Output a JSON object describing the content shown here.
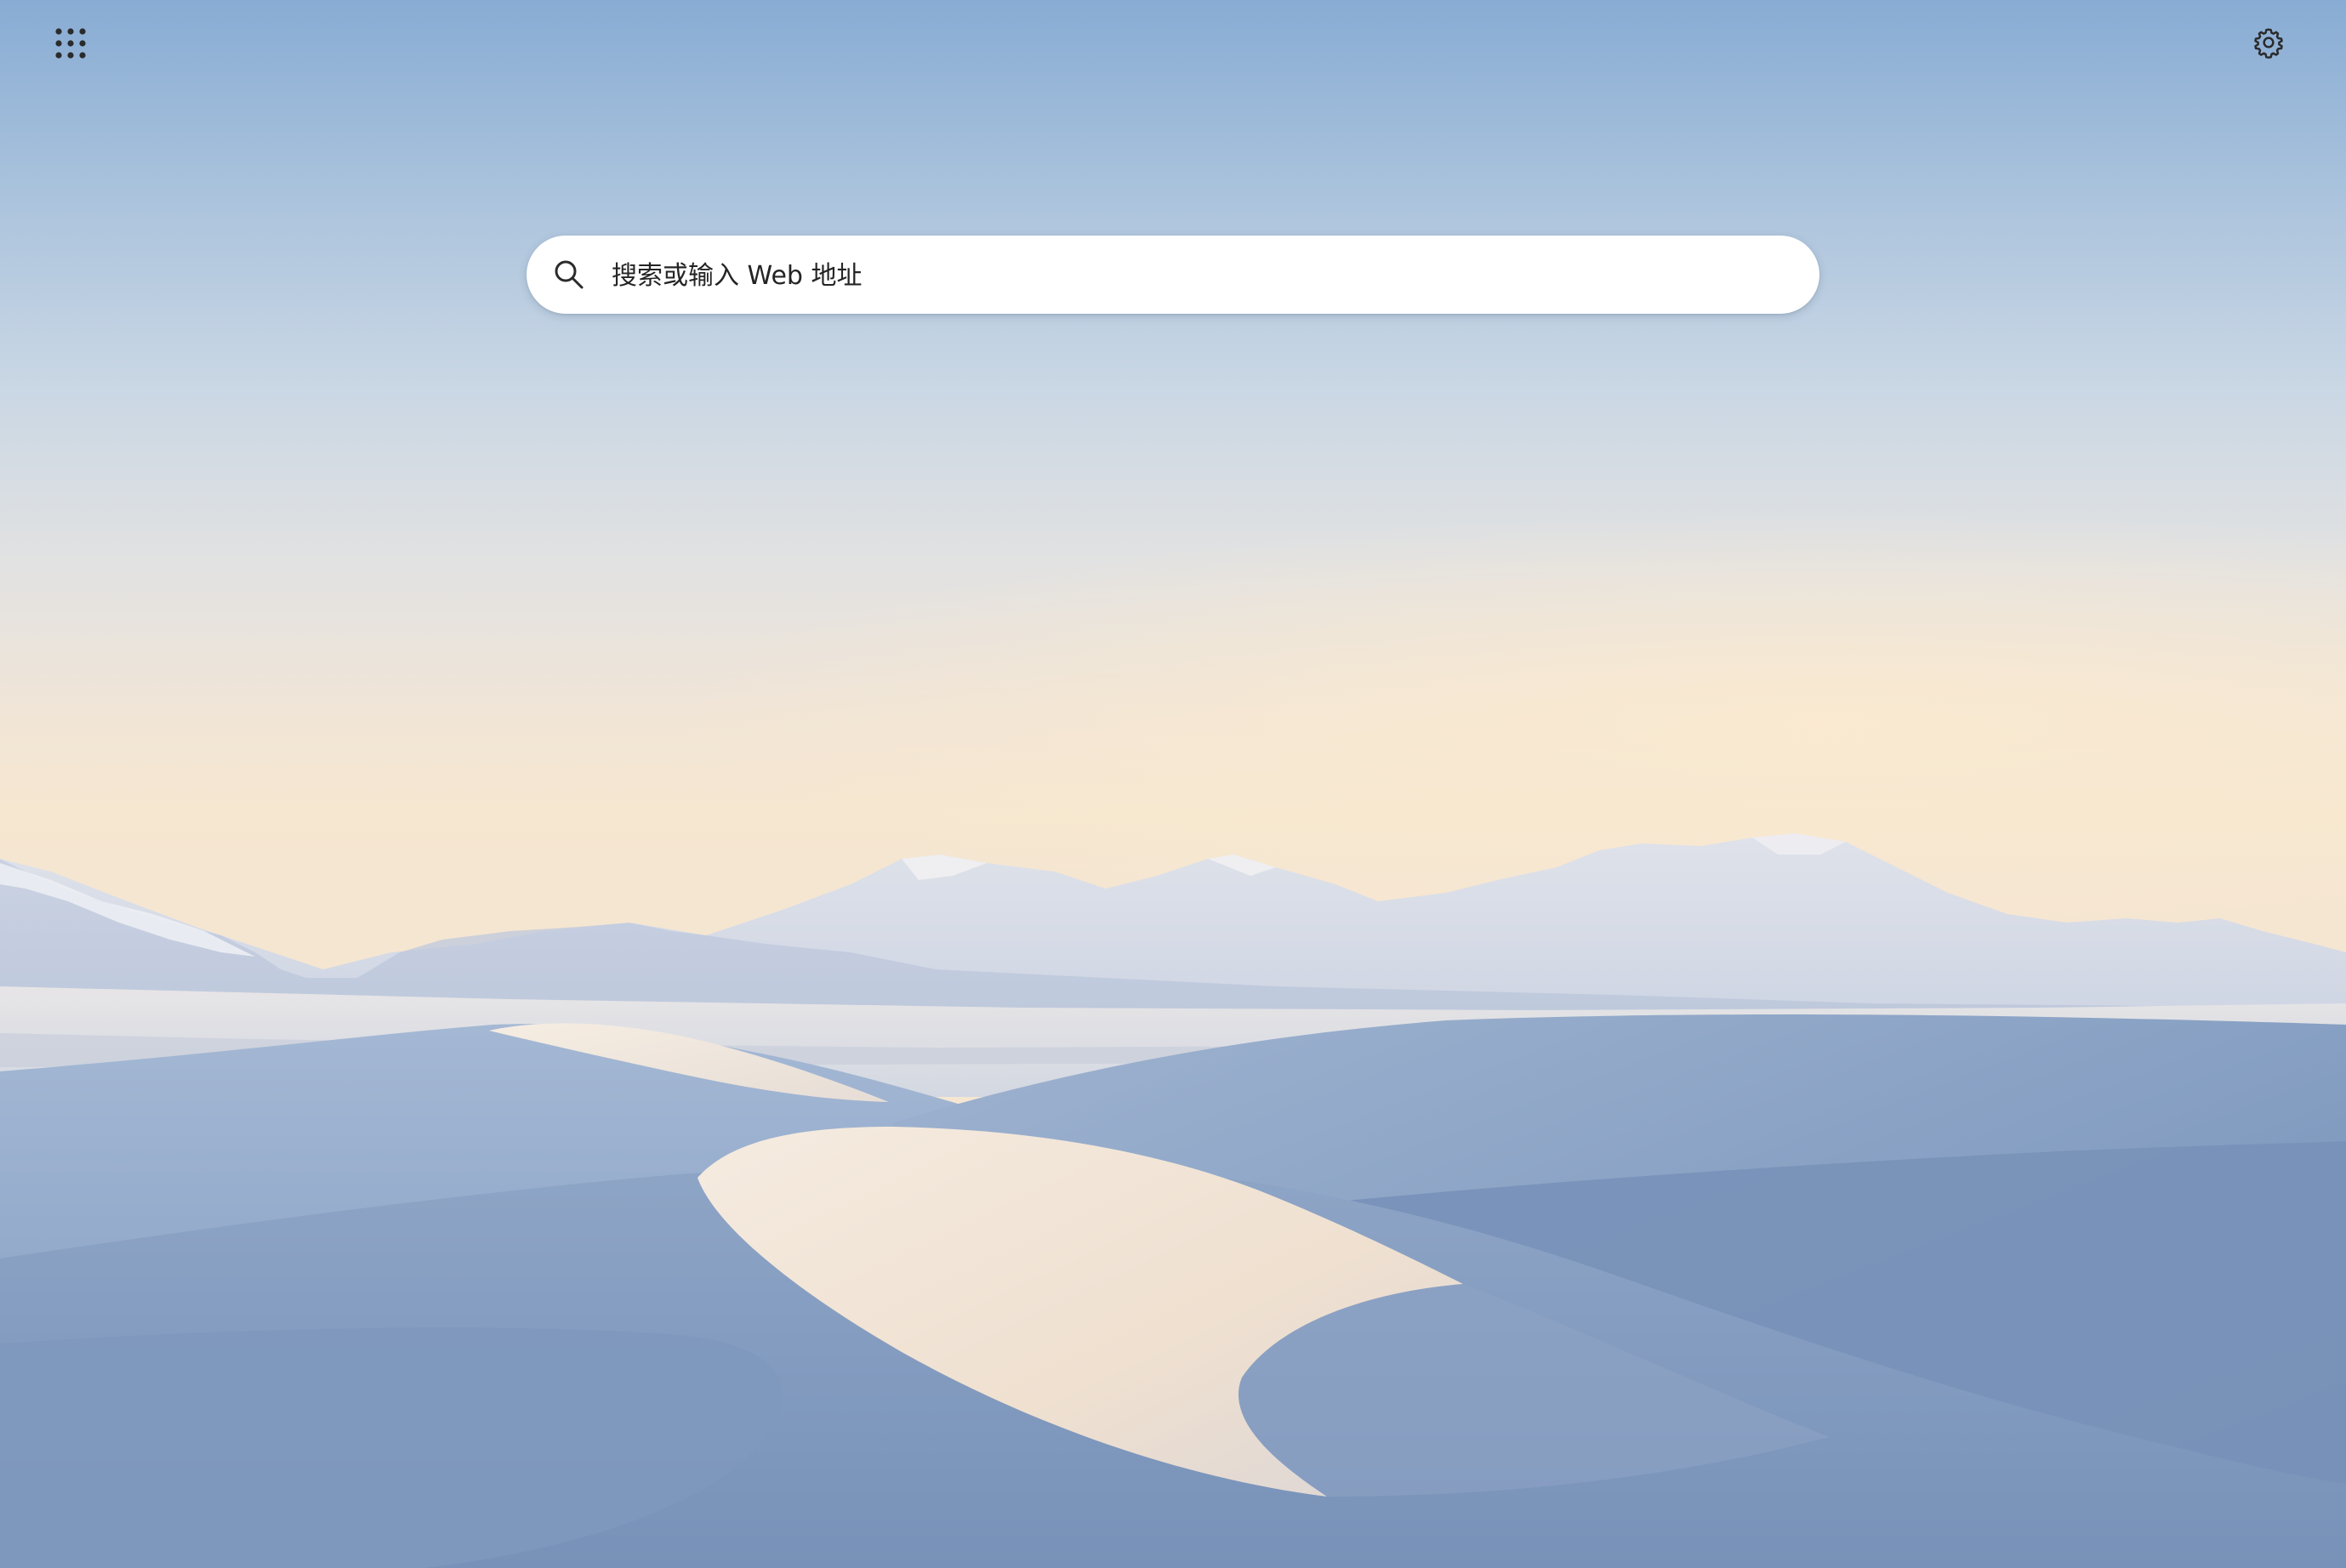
{
  "toolbar": {
    "apps_icon": "apps-grid-icon",
    "settings_icon": "gear-icon"
  },
  "search": {
    "placeholder": "搜索或输入 Web 地址",
    "value": "",
    "icon": "search-icon"
  },
  "colors": {
    "sky_top": "#88acd4",
    "sky_horizon": "#f6e7d0",
    "dune_shadow": "#7c98bd",
    "dune_light": "#f3e9dc",
    "icon": "#2b2b2b"
  }
}
